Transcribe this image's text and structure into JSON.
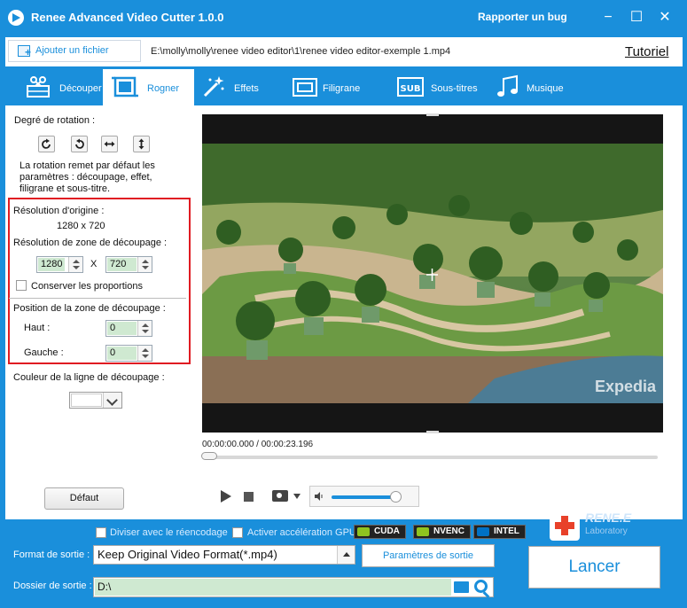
{
  "window": {
    "title": "Renee Advanced Video Cutter 1.0.0",
    "report_bug": "Rapporter un bug",
    "minimize": "−",
    "maximize": "☐",
    "close": "✕"
  },
  "filebar": {
    "add_file": "Ajouter un fichier",
    "file_path": "E:\\molly\\molly\\renee video editor\\1\\renee video editor-exemple 1.mp4",
    "tutorial": "Tutoriel"
  },
  "tabs": [
    {
      "label": "Découper",
      "icon": "scissors-film-icon",
      "active": false
    },
    {
      "label": "Rogner",
      "icon": "crop-icon",
      "active": true
    },
    {
      "label": "Effets",
      "icon": "magic-wand-icon",
      "active": false
    },
    {
      "label": "Filigrane",
      "icon": "watermark-icon",
      "active": false
    },
    {
      "label": "Sous-titres",
      "icon": "subtitle-icon",
      "active": false
    },
    {
      "label": "Musique",
      "icon": "music-note-icon",
      "active": false
    }
  ],
  "crop": {
    "rotation_title": "Degré de rotation :",
    "rotation_buttons": [
      "rotate-right-icon",
      "rotate-left-icon",
      "flip-horizontal-icon",
      "flip-vertical-icon"
    ],
    "rotation_note_1": "La rotation remet par défaut les",
    "rotation_note_2": "paramètres : découpage, effet,",
    "rotation_note_3": "filigrane et sous-titre.",
    "original_res_label": "Résolution d'origine :",
    "original_res_value": "1280 x 720",
    "crop_res_label": "Résolution de zone de découpage :",
    "crop_width": "1280",
    "crop_x": "X",
    "crop_height": "720",
    "keep_ratio": "Conserver les proportions",
    "position_label": "Position de la zone de découpage :",
    "top_label": "Haut :",
    "top_value": "0",
    "left_label": "Gauche :",
    "left_value": "0",
    "line_color_label": "Couleur de la ligne de découpage :",
    "line_color": "#ffffff",
    "default_btn": "Défaut"
  },
  "player": {
    "watermark": "Expedia",
    "time": "00:00:00.000 / 00:00:23.196",
    "progress": 0,
    "volume": 0.85
  },
  "bottom": {
    "split_reencode": "Diviser avec le réencodage",
    "gpu_accel": "Activer accélération GPU",
    "gpu_cuda": "CUDA",
    "gpu_nvenc": "NVENC",
    "gpu_intel": "INTEL",
    "brand_name": "RENE.E",
    "brand_sub": "Laboratory",
    "format_label": "Format de sortie :",
    "format_value": "Keep Original Video Format(*.mp4)",
    "params_btn": "Paramètres de sortie",
    "folder_label": "Dossier de sortie :",
    "folder_value": "D:\\",
    "launch_btn": "Lancer"
  },
  "colors": {
    "accent": "#1a8fdb",
    "highlight_box": "#e01b22",
    "input_fill": "#cfe9d1"
  }
}
